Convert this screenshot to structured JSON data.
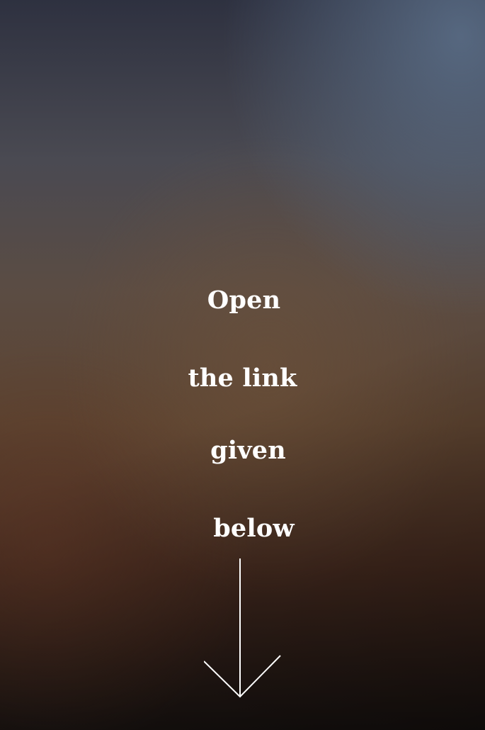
{
  "message": {
    "lines": [
      "Open",
      "the link",
      "given",
      "below"
    ]
  },
  "icons": {
    "arrow": "arrow-down-icon"
  },
  "colors": {
    "text": "#ffffff",
    "arrow": "#ffffff"
  }
}
